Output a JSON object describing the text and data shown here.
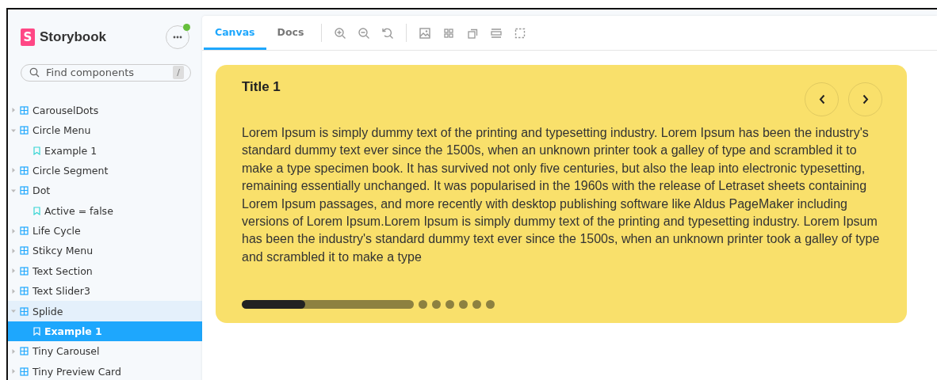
{
  "sidebar": {
    "brand": {
      "logo_letter": "S",
      "name": "Storybook"
    },
    "menu_has_update": true,
    "search": {
      "placeholder": "Find components",
      "shortcut": "/"
    },
    "tree": [
      {
        "label": "CarouselDots",
        "kind": "component",
        "expanded": false
      },
      {
        "label": "Circle Menu",
        "kind": "component",
        "expanded": true,
        "children": [
          {
            "label": "Example 1",
            "kind": "story",
            "selected": false
          }
        ]
      },
      {
        "label": "Circle Segment",
        "kind": "component",
        "expanded": false
      },
      {
        "label": "Dot",
        "kind": "component",
        "expanded": true,
        "children": [
          {
            "label": "Active = false",
            "kind": "story",
            "selected": false
          }
        ]
      },
      {
        "label": "Life Cycle",
        "kind": "component",
        "expanded": false
      },
      {
        "label": "Stikcy Menu",
        "kind": "component",
        "expanded": false
      },
      {
        "label": "Text Section",
        "kind": "component",
        "expanded": false
      },
      {
        "label": "Text Slider3",
        "kind": "component",
        "expanded": false
      },
      {
        "label": "Splide",
        "kind": "component",
        "expanded": true,
        "children": [
          {
            "label": "Example 1",
            "kind": "story",
            "selected": true
          }
        ]
      },
      {
        "label": "Tiny Carousel",
        "kind": "component",
        "expanded": false
      },
      {
        "label": "Tiny Preview Card",
        "kind": "component",
        "expanded": false
      }
    ]
  },
  "toolbar": {
    "tabs": [
      {
        "label": "Canvas",
        "selected": true
      },
      {
        "label": "Docs",
        "selected": false
      }
    ],
    "tools": [
      {
        "kind": "zoom-in"
      },
      {
        "kind": "zoom-out"
      },
      {
        "kind": "reset"
      },
      {
        "kind": "divider"
      },
      {
        "kind": "image"
      },
      {
        "kind": "grid"
      },
      {
        "kind": "frames"
      },
      {
        "kind": "bar"
      },
      {
        "kind": "outline"
      }
    ]
  },
  "slide": {
    "title": "Title 1",
    "body": "Lorem Ipsum is simply dummy text of the printing and typesetting industry. Lorem Ipsum has been the industry's standard dummy text ever since the 1500s, when an unknown printer took a galley of type and scrambled it to make a type specimen book. It has survived not only five centuries, but also the leap into electronic typesetting, remaining essentially unchanged. It was popularised in the 1960s with the release of Letraset sheets containing Lorem Ipsum passages, and more recently with desktop publishing software like Aldus PageMaker including versions of Lorem Ipsum.Lorem Ipsum is simply dummy text of the printing and typesetting industry. Lorem Ipsum has been the industry's standard dummy text ever since the 1500s, when an unknown printer took a galley of type and scrambled it to make a type",
    "progress": {
      "level": 0.37
    },
    "pages": [
      {
        "selected": true
      },
      {
        "selected": false
      },
      {
        "selected": false
      },
      {
        "selected": false
      },
      {
        "selected": false
      },
      {
        "selected": false
      },
      {
        "selected": false
      }
    ]
  }
}
